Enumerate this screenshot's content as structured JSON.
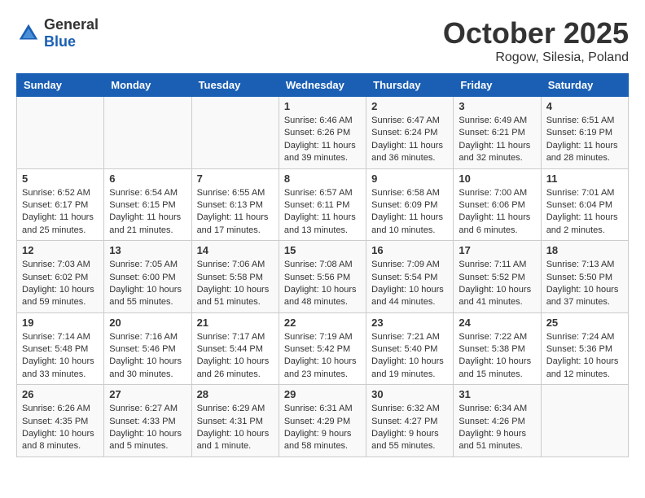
{
  "header": {
    "logo": {
      "text_general": "General",
      "text_blue": "Blue"
    },
    "title": "October 2025",
    "location": "Rogow, Silesia, Poland"
  },
  "calendar": {
    "days_of_week": [
      "Sunday",
      "Monday",
      "Tuesday",
      "Wednesday",
      "Thursday",
      "Friday",
      "Saturday"
    ],
    "weeks": [
      [
        {
          "day": "",
          "info": ""
        },
        {
          "day": "",
          "info": ""
        },
        {
          "day": "",
          "info": ""
        },
        {
          "day": "1",
          "info": "Sunrise: 6:46 AM\nSunset: 6:26 PM\nDaylight: 11 hours\nand 39 minutes."
        },
        {
          "day": "2",
          "info": "Sunrise: 6:47 AM\nSunset: 6:24 PM\nDaylight: 11 hours\nand 36 minutes."
        },
        {
          "day": "3",
          "info": "Sunrise: 6:49 AM\nSunset: 6:21 PM\nDaylight: 11 hours\nand 32 minutes."
        },
        {
          "day": "4",
          "info": "Sunrise: 6:51 AM\nSunset: 6:19 PM\nDaylight: 11 hours\nand 28 minutes."
        }
      ],
      [
        {
          "day": "5",
          "info": "Sunrise: 6:52 AM\nSunset: 6:17 PM\nDaylight: 11 hours\nand 25 minutes."
        },
        {
          "day": "6",
          "info": "Sunrise: 6:54 AM\nSunset: 6:15 PM\nDaylight: 11 hours\nand 21 minutes."
        },
        {
          "day": "7",
          "info": "Sunrise: 6:55 AM\nSunset: 6:13 PM\nDaylight: 11 hours\nand 17 minutes."
        },
        {
          "day": "8",
          "info": "Sunrise: 6:57 AM\nSunset: 6:11 PM\nDaylight: 11 hours\nand 13 minutes."
        },
        {
          "day": "9",
          "info": "Sunrise: 6:58 AM\nSunset: 6:09 PM\nDaylight: 11 hours\nand 10 minutes."
        },
        {
          "day": "10",
          "info": "Sunrise: 7:00 AM\nSunset: 6:06 PM\nDaylight: 11 hours\nand 6 minutes."
        },
        {
          "day": "11",
          "info": "Sunrise: 7:01 AM\nSunset: 6:04 PM\nDaylight: 11 hours\nand 2 minutes."
        }
      ],
      [
        {
          "day": "12",
          "info": "Sunrise: 7:03 AM\nSunset: 6:02 PM\nDaylight: 10 hours\nand 59 minutes."
        },
        {
          "day": "13",
          "info": "Sunrise: 7:05 AM\nSunset: 6:00 PM\nDaylight: 10 hours\nand 55 minutes."
        },
        {
          "day": "14",
          "info": "Sunrise: 7:06 AM\nSunset: 5:58 PM\nDaylight: 10 hours\nand 51 minutes."
        },
        {
          "day": "15",
          "info": "Sunrise: 7:08 AM\nSunset: 5:56 PM\nDaylight: 10 hours\nand 48 minutes."
        },
        {
          "day": "16",
          "info": "Sunrise: 7:09 AM\nSunset: 5:54 PM\nDaylight: 10 hours\nand 44 minutes."
        },
        {
          "day": "17",
          "info": "Sunrise: 7:11 AM\nSunset: 5:52 PM\nDaylight: 10 hours\nand 41 minutes."
        },
        {
          "day": "18",
          "info": "Sunrise: 7:13 AM\nSunset: 5:50 PM\nDaylight: 10 hours\nand 37 minutes."
        }
      ],
      [
        {
          "day": "19",
          "info": "Sunrise: 7:14 AM\nSunset: 5:48 PM\nDaylight: 10 hours\nand 33 minutes."
        },
        {
          "day": "20",
          "info": "Sunrise: 7:16 AM\nSunset: 5:46 PM\nDaylight: 10 hours\nand 30 minutes."
        },
        {
          "day": "21",
          "info": "Sunrise: 7:17 AM\nSunset: 5:44 PM\nDaylight: 10 hours\nand 26 minutes."
        },
        {
          "day": "22",
          "info": "Sunrise: 7:19 AM\nSunset: 5:42 PM\nDaylight: 10 hours\nand 23 minutes."
        },
        {
          "day": "23",
          "info": "Sunrise: 7:21 AM\nSunset: 5:40 PM\nDaylight: 10 hours\nand 19 minutes."
        },
        {
          "day": "24",
          "info": "Sunrise: 7:22 AM\nSunset: 5:38 PM\nDaylight: 10 hours\nand 15 minutes."
        },
        {
          "day": "25",
          "info": "Sunrise: 7:24 AM\nSunset: 5:36 PM\nDaylight: 10 hours\nand 12 minutes."
        }
      ],
      [
        {
          "day": "26",
          "info": "Sunrise: 6:26 AM\nSunset: 4:35 PM\nDaylight: 10 hours\nand 8 minutes."
        },
        {
          "day": "27",
          "info": "Sunrise: 6:27 AM\nSunset: 4:33 PM\nDaylight: 10 hours\nand 5 minutes."
        },
        {
          "day": "28",
          "info": "Sunrise: 6:29 AM\nSunset: 4:31 PM\nDaylight: 10 hours\nand 1 minute."
        },
        {
          "day": "29",
          "info": "Sunrise: 6:31 AM\nSunset: 4:29 PM\nDaylight: 9 hours\nand 58 minutes."
        },
        {
          "day": "30",
          "info": "Sunrise: 6:32 AM\nSunset: 4:27 PM\nDaylight: 9 hours\nand 55 minutes."
        },
        {
          "day": "31",
          "info": "Sunrise: 6:34 AM\nSunset: 4:26 PM\nDaylight: 9 hours\nand 51 minutes."
        },
        {
          "day": "",
          "info": ""
        }
      ]
    ]
  }
}
